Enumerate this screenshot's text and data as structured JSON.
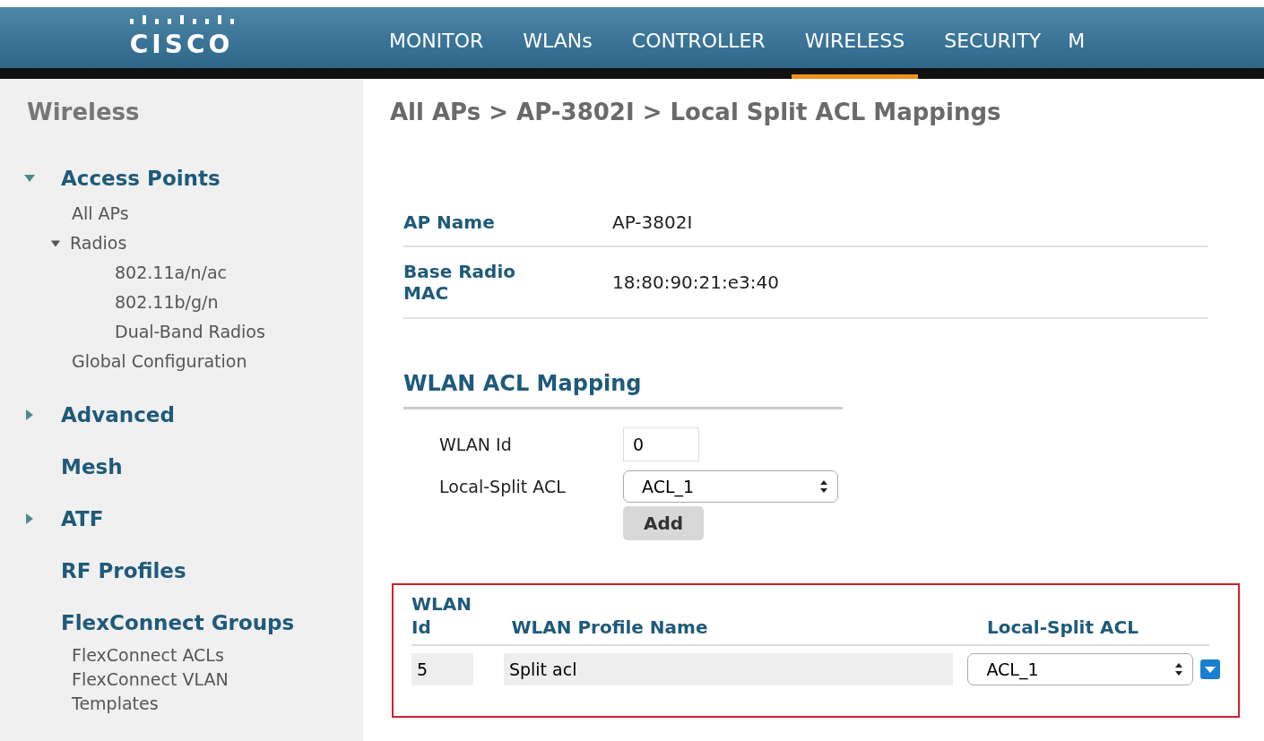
{
  "header": {
    "logo": "CISCO",
    "tabs": [
      {
        "label": "MONITOR",
        "selected": false
      },
      {
        "label": "WLANs",
        "selected": false
      },
      {
        "label": "CONTROLLER",
        "selected": false
      },
      {
        "label": "WIRELESS",
        "selected": true
      },
      {
        "label": "SECURITY",
        "selected": false
      },
      {
        "label": "M",
        "selected": false
      }
    ]
  },
  "sidebar": {
    "title": "Wireless",
    "items": [
      {
        "label": "Access Points",
        "kind": "group",
        "expanded": true,
        "children": [
          {
            "label": "All APs"
          },
          {
            "label": "Radios",
            "expanded": true,
            "children": [
              {
                "label": "802.11a/n/ac"
              },
              {
                "label": "802.11b/g/n"
              },
              {
                "label": "Dual-Band Radios"
              }
            ]
          },
          {
            "label": "Global Configuration"
          }
        ]
      },
      {
        "label": "Advanced",
        "kind": "group",
        "expanded": false
      },
      {
        "label": "Mesh",
        "kind": "link"
      },
      {
        "label": "ATF",
        "kind": "group",
        "expanded": false
      },
      {
        "label": "RF Profiles",
        "kind": "link"
      },
      {
        "label": "FlexConnect Groups",
        "kind": "link",
        "children": [
          {
            "label": "FlexConnect ACLs"
          },
          {
            "label": "FlexConnect VLAN Templates"
          }
        ]
      }
    ]
  },
  "content": {
    "title": "All APs > AP-3802I > Local Split ACL Mappings",
    "details": [
      {
        "label": "AP Name",
        "value": "AP-3802I"
      },
      {
        "label": "Base Radio MAC",
        "value": "18:80:90:21:e3:40"
      }
    ],
    "mapping": {
      "heading": "WLAN ACL Mapping",
      "wlan_id_label": "WLAN Id",
      "wlan_id_value": "0",
      "acl_label": "Local-Split ACL",
      "acl_value": "ACL_1",
      "add_button": "Add"
    },
    "table": {
      "columns": [
        "WLAN Id",
        "WLAN Profile Name",
        "Local-Split ACL"
      ],
      "rows": [
        {
          "wlan_id": "5",
          "profile": "Split acl",
          "acl": "ACL_1"
        }
      ]
    }
  }
}
